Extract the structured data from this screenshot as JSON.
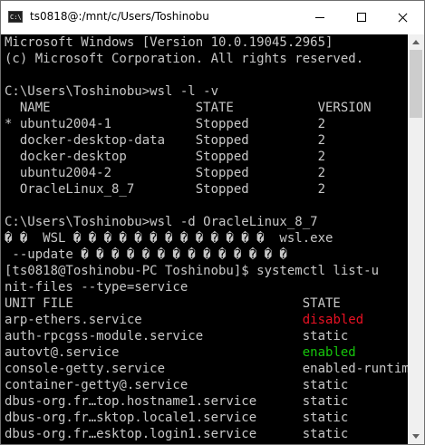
{
  "window": {
    "icon_text": "C:\\",
    "title": "ts0818@:/mnt/c/Users/Toshinobu"
  },
  "colors": {
    "terminal_bg": "#000000",
    "terminal_fg": "#c8c8c8",
    "disabled": "#e81123",
    "enabled": "#16c60c"
  },
  "console": {
    "lines": [
      "Microsoft Windows [Version 10.0.19045.2965]",
      "(c) Microsoft Corporation. All rights reserved.",
      "",
      "C:\\Users\\Toshinobu>wsl -l -v",
      "  NAME                   STATE           VERSION",
      "* ubuntu2004-1           Stopped         2",
      "  docker-desktop-data    Stopped         2",
      "  docker-desktop         Stopped         2",
      "  ubuntu2004-2           Stopped         2",
      "  OracleLinux_8_7        Stopped         2",
      "",
      "C:\\Users\\Toshinobu>wsl -d OracleLinux_8_7",
      "� �  WSL � � � � � � � � � � � � �  wsl.exe",
      " --update � � � � � � � � � � � � � �",
      "[ts0818@Toshinobu-PC Toshinobu]$ systemctl list-u",
      "nit-files --type=service",
      "UNIT FILE                              STATE",
      "arp-ethers.service                     ",
      "auth-rpcgss-module.service             static",
      "autovt@.service                        ",
      "console-getty.service                  enabled-runtime",
      "container-getty@.service               static",
      "dbus-org.fr…top.hostname1.service      static",
      "dbus-org.fr…sktop.locale1.service      static",
      "dbus-org.fr…esktop.login1.service      static"
    ],
    "status_disabled": "disabled",
    "status_enabled": "enabled"
  }
}
